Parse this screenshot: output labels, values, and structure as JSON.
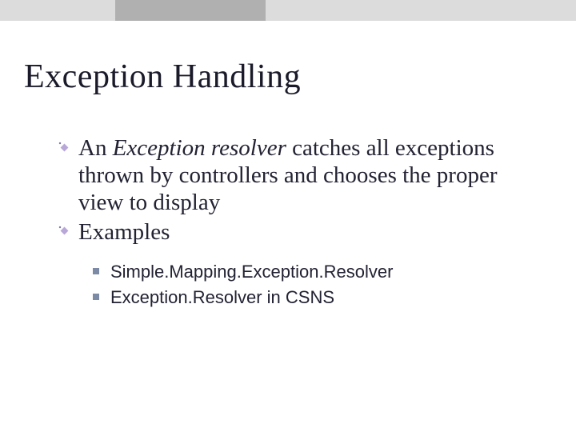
{
  "title": "Exception Handling",
  "bullets": [
    {
      "pre": "An ",
      "italic": "Exception resolver ",
      "post": "catches all exceptions thrown by controllers and chooses the proper view to display"
    },
    {
      "text": "Examples"
    }
  ],
  "subbullets": [
    "Simple.Mapping.Exception.Resolver",
    "Exception.Resolver in CSNS"
  ]
}
